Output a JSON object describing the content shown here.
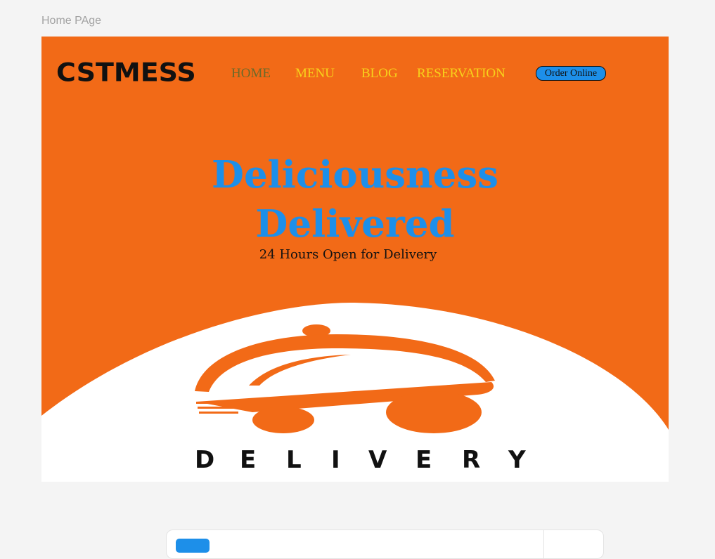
{
  "frame": {
    "label": "Home PAge"
  },
  "brand": {
    "logo": "CSTMESS"
  },
  "nav": {
    "home": "HOME",
    "menu": "MENU",
    "blog": "BLOG",
    "reservation": "RESERVATION",
    "order_online": "Order Online"
  },
  "hero": {
    "title_line1": "Deliciousness",
    "title_line2": "Delivered",
    "subtitle": "24 Hours Open for Delivery"
  },
  "delivery_logo": {
    "letters": [
      "D",
      "E",
      "L",
      "I",
      "V",
      "E",
      "R",
      "Y"
    ]
  },
  "colors": {
    "background": "#f4f4f4",
    "hero_orange": "#f26a17",
    "accent_blue": "#1d8fe9",
    "nav_yellow": "#f7d21b",
    "nav_active": "#6d6a2a"
  }
}
